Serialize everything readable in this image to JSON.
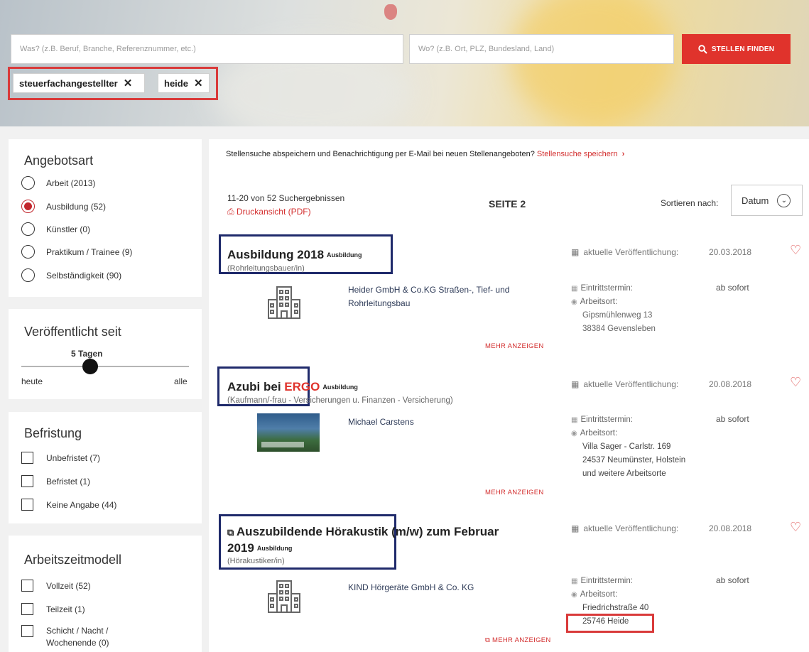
{
  "search": {
    "what_placeholder": "Was? (z.B. Beruf, Branche, Referenznummer, etc.)",
    "where_placeholder": "Wo? (z.B. Ort, PLZ, Bundesland, Land)",
    "button_label": "STELLEN FINDEN",
    "tags": [
      "steuerfachangestellter",
      "heide"
    ]
  },
  "sidebar": {
    "offer_type": {
      "title": "Angebotsart",
      "options": [
        "Arbeit (2013)",
        "Ausbildung (52)",
        "Künstler (0)",
        "Praktikum / Trainee (9)",
        "Selbständigkeit (90)"
      ],
      "selected": "Ausbildung (52)"
    },
    "published": {
      "title": "Veröffentlicht seit",
      "value": "5 Tagen",
      "min_label": "heute",
      "max_label": "alle"
    },
    "limitation": {
      "title": "Befristung",
      "options": [
        "Unbefristet (7)",
        "Befristet (1)",
        "Keine Angabe (44)"
      ]
    },
    "worktime": {
      "title": "Arbeitszeitmodell",
      "options": [
        "Vollzeit (52)",
        "Teilzeit (1)",
        "Schicht / Nacht /",
        "Wochenende (0)"
      ]
    }
  },
  "main": {
    "save_text": "Stellensuche abspeichern und Benachrichtigung per E-Mail bei neuen Stellenangeboten?",
    "save_link": "Stellensuche speichern",
    "count": "11-20 von 52 Suchergebnissen",
    "pdf": "Druckansicht (PDF)",
    "page": "SEITE 2",
    "sort_label": "Sortieren nach:",
    "sort_value": "Datum",
    "pub_label": "aktuelle Veröffentlichung:",
    "entry_label": "Eintrittstermin:",
    "place_label": "Arbeitsort:",
    "more_label": "MEHR ANZEIGEN",
    "jobs": [
      {
        "title": "Ausbildung 2018",
        "badge": "Ausbildung",
        "subtitle": "(Rohrleitungsbauer/in)",
        "date": "20.03.2018",
        "company_line1": "Heider GmbH & Co.KG Straßen-, Tief- und",
        "company_line2": "Rohrleitungsbau",
        "entry": "ab sofort",
        "address1": "Gipsmühlenweg 13",
        "address2": "38384 Gevensleben"
      },
      {
        "title_pre": "Azubi bei ",
        "title_brand": "ERGO",
        "badge": "Ausbildung",
        "subtitle": "(Kaufmann/-frau - Versicherungen u. Finanzen - Versicherung)",
        "date": "20.08.2018",
        "company_line1": "Michael Carstens",
        "entry": "ab sofort",
        "address1": "Villa Sager - Carlstr. 169",
        "address2": "24537 Neumünster, Holstein",
        "address3": "und weitere Arbeitsorte"
      },
      {
        "title_line1": "Auszubildende Hörakustik (m/w) zum Februar",
        "title_line2": "2019",
        "badge": "Ausbildung",
        "subtitle": "(Hörakustiker/in)",
        "date": "20.08.2018",
        "company_line1": "KIND Hörgeräte GmbH & Co. KG",
        "entry": "ab sofort",
        "address1": "Friedrichstraße 40",
        "address2": "25746 Heide"
      }
    ]
  },
  "colors": {
    "accent": "#e0332c",
    "highlight_blue": "#1f2a6b",
    "highlight_red": "#d93a3a"
  }
}
